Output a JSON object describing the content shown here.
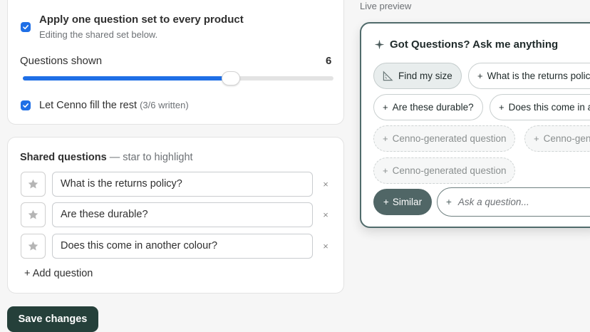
{
  "settings": {
    "apply_label": "Apply one question set to every product",
    "apply_sub": "Editing the shared set below.",
    "questions_shown_label": "Questions shown",
    "questions_shown_value": "6",
    "slider_fraction": 0.67,
    "fill_rest_label": "Let Cenno fill the rest",
    "fill_rest_count": "(3/6 written)"
  },
  "shared": {
    "heading": "Shared questions",
    "hint": "— star to highlight",
    "questions": [
      "What is the returns policy?",
      "Are these durable?",
      "Does this come in another colour?"
    ],
    "remove_glyph": "×",
    "add_label": "+ Add question"
  },
  "save_label": "Save changes",
  "preview": {
    "label": "Live preview",
    "title": "Got Questions? Ask me anything",
    "chips": {
      "find_size": "Find my size",
      "returns": "What is the returns policy?",
      "durable": "Are these durable?",
      "colour": "Does this come in another colour?",
      "generated": "Cenno-generated question"
    },
    "plus": "+",
    "similar_label": "Similar",
    "ask_placeholder": "Ask a question..."
  },
  "colors": {
    "accent": "#1f6fe6",
    "save_button": "#25403a",
    "widget_border": "#506b6b",
    "similar_button": "#506666"
  }
}
